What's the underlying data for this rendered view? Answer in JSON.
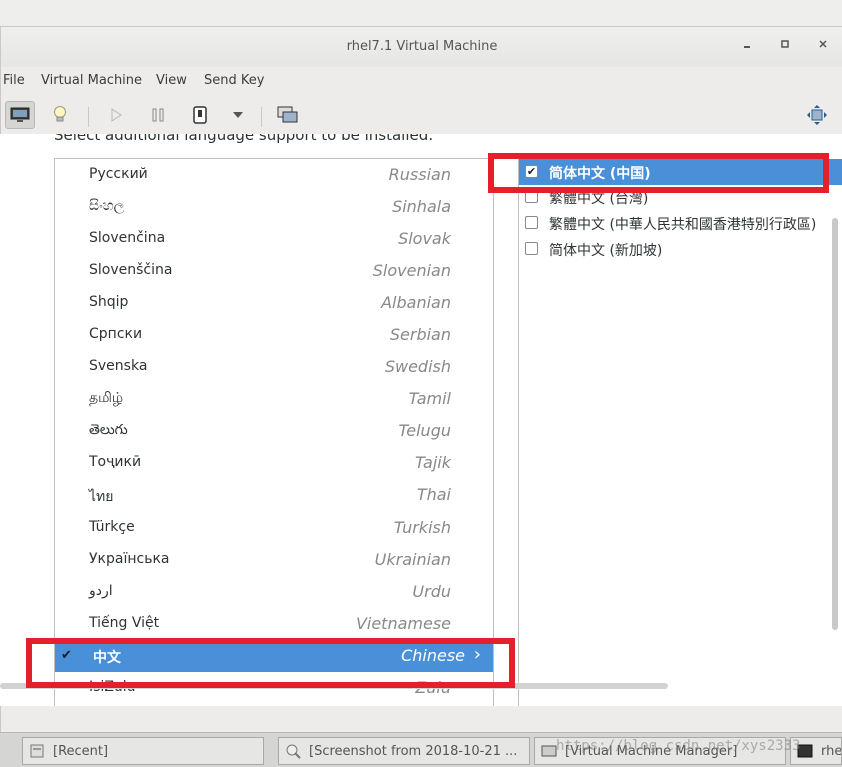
{
  "window": {
    "title": "rhel7.1 Virtual Machine"
  },
  "menu": [
    {
      "id": "file",
      "label": "File"
    },
    {
      "id": "virtual-machine",
      "label": "Virtual Machine"
    },
    {
      "id": "view",
      "label": "View"
    },
    {
      "id": "send-key",
      "label": "Send Key"
    }
  ],
  "toolbar": {
    "icons": [
      "monitor-icon",
      "lightbulb-icon",
      "play-icon",
      "pause-icon",
      "power-icon",
      "dropdown-arrow-icon",
      "snapshots-icon",
      "fullscreen-icon"
    ]
  },
  "installer": {
    "cut_heading": "Select additional language support to be installed:",
    "languages": [
      {
        "native": "Русский",
        "english": "Russian"
      },
      {
        "native": "සිංහල",
        "english": "Sinhala"
      },
      {
        "native": "Slovenčina",
        "english": "Slovak"
      },
      {
        "native": "Slovenščina",
        "english": "Slovenian"
      },
      {
        "native": "Shqip",
        "english": "Albanian"
      },
      {
        "native": "Српски",
        "english": "Serbian"
      },
      {
        "native": "Svenska",
        "english": "Swedish"
      },
      {
        "native": "தமிழ்",
        "english": "Tamil"
      },
      {
        "native": "తెలుగు",
        "english": "Telugu"
      },
      {
        "native": "Тоҷикӣ",
        "english": "Tajik"
      },
      {
        "native": "ไทย",
        "english": "Thai"
      },
      {
        "native": "Türkçe",
        "english": "Turkish"
      },
      {
        "native": "Українська",
        "english": "Ukrainian"
      },
      {
        "native": "اردو",
        "english": "Urdu"
      },
      {
        "native": "Tiếng Việt",
        "english": "Vietnamese"
      },
      {
        "native": "中文",
        "english": "Chinese",
        "selected": true,
        "checked": true
      },
      {
        "native": "IsiZulu",
        "english": "Zulu"
      }
    ],
    "locales": [
      {
        "label": "简体中文 (中国)",
        "checked": true,
        "selected": true
      },
      {
        "label": "繁體中文 (台灣)",
        "checked": false
      },
      {
        "label": "繁體中文 (中華人民共和國香港特別行政區)",
        "checked": false
      },
      {
        "label": "简体中文 (新加坡)",
        "checked": false
      }
    ]
  },
  "taskbar": [
    {
      "label": "[Recent]",
      "icon": "files-icon"
    },
    {
      "label": "[Screenshot from 2018-10-21 ...",
      "icon": "screenshot-icon"
    },
    {
      "label": "[Virtual Machine Manager]",
      "icon": "vm-manager-icon"
    },
    {
      "label": "rhe",
      "icon": "terminal-icon"
    }
  ],
  "watermark": "https://blog.csdn.net/xys2333",
  "colors": {
    "selection": "#4a90d9",
    "annotation_red": "#e5202b"
  }
}
